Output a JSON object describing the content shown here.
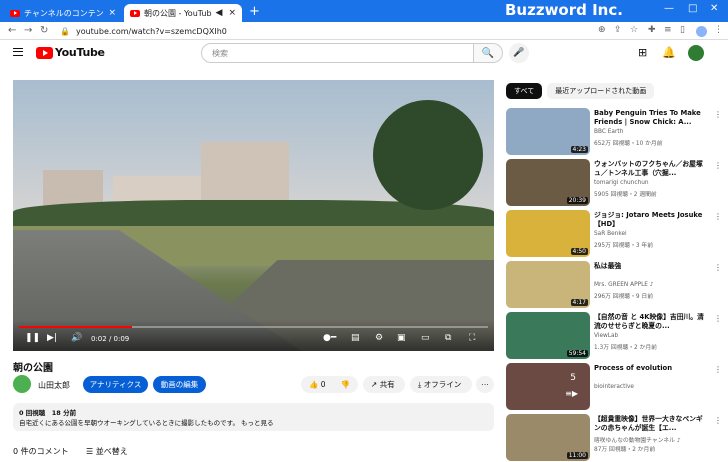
{
  "browser": {
    "tabs": [
      {
        "title": "チャンネルのコンテンツ - YouTube Studio",
        "close": "×"
      },
      {
        "title": "朝の公園 - YouTube",
        "close": "×"
      }
    ],
    "new_tab": "+",
    "brand": "Buzzword Inc.",
    "url": "youtube.com/watch?v=szemcDQXIh0"
  },
  "header": {
    "logo_text": "YouTube",
    "search_placeholder": "検索"
  },
  "player": {
    "progress_fraction": 0.24,
    "time": "0:02 / 0:09"
  },
  "video": {
    "title": "朝の公園",
    "channel": "山田太郎",
    "analytics_label": "アナリティクス",
    "edit_label": "動画の編集",
    "likes": "0",
    "share_label": "共有",
    "offline_label": "オフライン",
    "meta": "0 回視聴　18 分前",
    "description": "自宅近くにある公園を早朝ウオーキングしているときに撮影したものです。 もっと見る"
  },
  "comments": {
    "count_label": "0 件のコメント",
    "sort_label": "並べ替え"
  },
  "sidebar": {
    "chips": [
      "すべて",
      "最近アップロードされた動画"
    ],
    "items": [
      {
        "title": "Baby Penguin Tries To Make Friends | Snow Chick: A...",
        "channel": "BBC Earth",
        "stats": "652万 回視聴・10 か月前",
        "duration": "4:23",
        "color": "#8fa9c4"
      },
      {
        "title": "ウォンバットのフクちゃん／お屋塚 ュ／トンネル工事（穴掘...",
        "channel": "tomarigi chunchun",
        "stats": "5905 回視聴・2 週間前",
        "duration": "20:39",
        "color": "#6b5a44"
      },
      {
        "title": "ジョジョ: Jotaro Meets Josuke 【HD】",
        "channel": "SaR Benkei",
        "stats": "295万 回視聴・3 年前",
        "duration": "4:50",
        "color": "#d8b23a"
      },
      {
        "title": "私は最強",
        "channel": "Mrs. GREEN APPLE ♪",
        "stats": "296万 回視聴・9 日前",
        "duration": "4:17",
        "color": "#c9b47a"
      },
      {
        "title": "【自然の音 と 4K映像】吉田川。清流のせせらぎと晩夏の...",
        "channel": "ViewLab",
        "stats": "1.3万 回視聴・2 か月前",
        "duration": "59:54",
        "color": "#3a7a5a"
      },
      {
        "title": "Process of evolution",
        "channel": "biointeractive",
        "stats": "",
        "duration": "",
        "count": "5",
        "color": "#6a4a42"
      },
      {
        "title": "【超貴重映像】世界一大きなペンギンの赤ちゃんが誕生【エ...",
        "channel": "喀咲ゆんなの動物園チャンネル ♪",
        "stats": "87万 回視聴・2 か月前",
        "duration": "11:00",
        "color": "#9a8a6a"
      }
    ]
  }
}
